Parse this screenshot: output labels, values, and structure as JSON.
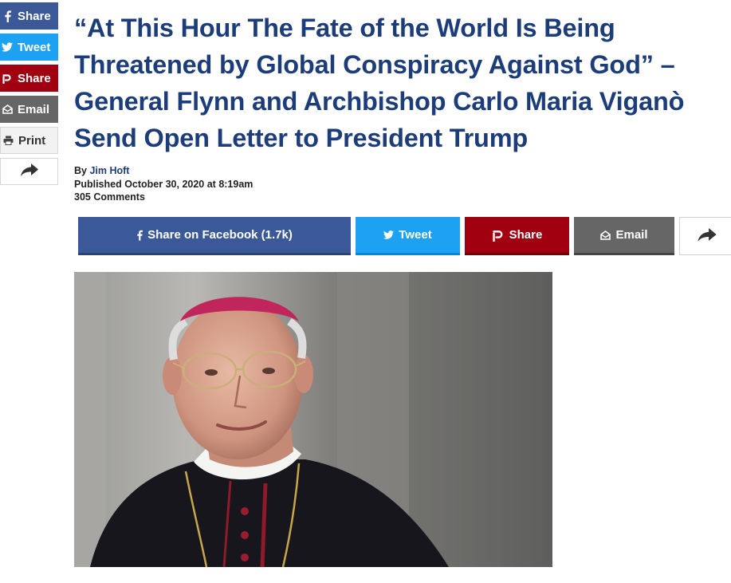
{
  "side_share": {
    "facebook": "Share",
    "twitter": "Tweet",
    "parler": "Share",
    "email": "Email",
    "print": "Print"
  },
  "article": {
    "headline": "“At This Hour The Fate of the World Is Being Threatened by Global Conspiracy Against God” – General Flynn and Archbishop Carlo Maria Viganò Send Open Letter to President Trump",
    "by_prefix": "By",
    "author": "Jim Hoft",
    "published": "Published October 30, 2020 at 8:19am",
    "comments": "305 Comments"
  },
  "share_row": {
    "facebook": "Share on Facebook (1.7k)",
    "twitter": "Tweet",
    "parler": "Share",
    "email": "Email"
  },
  "icons": {
    "facebook": "facebook-icon",
    "twitter": "twitter-icon",
    "parler": "parler-icon",
    "email": "envelope-icon",
    "print": "printer-icon",
    "more": "share-arrow-icon"
  },
  "colors": {
    "headline": "#1c3d7a",
    "facebook": "#3b5998",
    "twitter": "#1da1f2",
    "parler": "#a00010",
    "email": "#666666"
  }
}
